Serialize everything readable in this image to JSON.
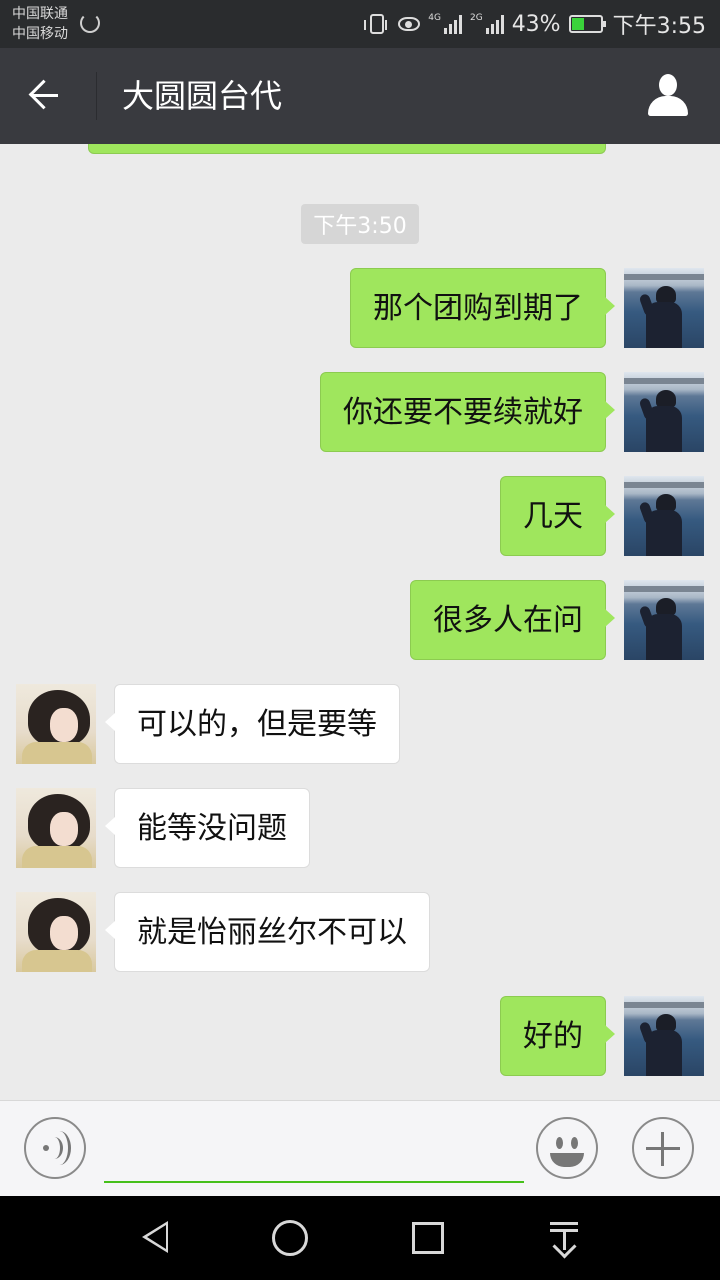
{
  "status_bar": {
    "carrier_1": "中国联通",
    "carrier_2": "中国移动",
    "network_4g": "4G",
    "network_2g": "2G",
    "battery_percent": "43%",
    "battery_level": 0.43,
    "time": "下午3:55",
    "icons": [
      "sync-icon",
      "vibrate-icon",
      "eye-comfort-icon",
      "signal-icon",
      "battery-icon"
    ]
  },
  "title_bar": {
    "title": "大圆圆台代",
    "icons": [
      "back-arrow-icon",
      "profile-icon"
    ]
  },
  "chat": {
    "timestamp": "下午3:50",
    "messages": [
      {
        "from": "me",
        "text": "那个团购到期了"
      },
      {
        "from": "me",
        "text": "你还要不要续就好"
      },
      {
        "from": "me",
        "text": "几天"
      },
      {
        "from": "me",
        "text": "很多人在问"
      },
      {
        "from": "other",
        "text": "可以的，但是要等"
      },
      {
        "from": "other",
        "text": "能等没问题"
      },
      {
        "from": "other",
        "text": "就是怡丽丝尔不可以"
      },
      {
        "from": "me",
        "text": "好的"
      }
    ]
  },
  "input_bar": {
    "value": "",
    "icons": [
      "voice-icon",
      "emoji-icon",
      "plus-icon"
    ]
  },
  "colors": {
    "status_bar_bg": "#2a2c2e",
    "title_bar_bg": "#393a3f",
    "chat_bg": "#ebebeb",
    "outgoing_bubble": "#9fe65d",
    "incoming_bubble": "#ffffff",
    "input_underline": "#46c01b"
  }
}
